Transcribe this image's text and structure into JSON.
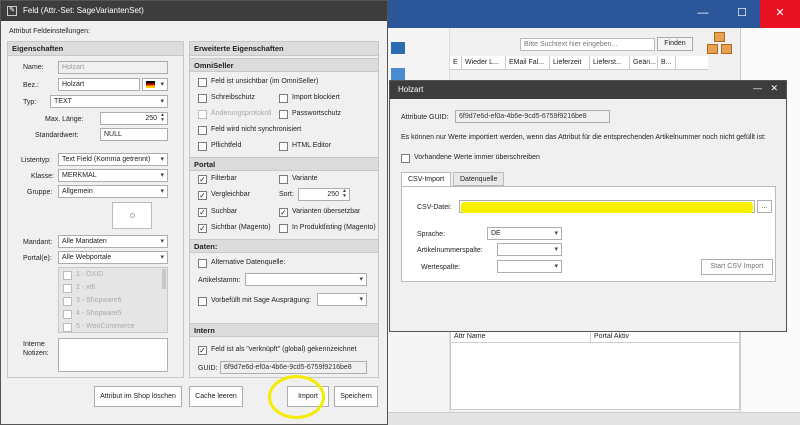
{
  "background_app": {
    "search_placeholder": "Bitte Suchtext hier eingeben...",
    "find_label": "Finden",
    "columns": [
      "E",
      "Wieder L...",
      "EMail Fal...",
      "Lieferzeit",
      "Lieferst...",
      "Geän...",
      "B..."
    ],
    "grid_columns": [
      "Attr Name",
      "Portal Aktiv"
    ]
  },
  "dialog1": {
    "title": "Feld (Attr.-Set: SageVariantenSet)",
    "subtitle": "Attribut Feldeinstellungen:",
    "eigenschaften": {
      "header": "Eigenschaften",
      "name_label": "Name:",
      "name_value": "Holzart",
      "bez_label": "Bez.:",
      "bez_value": "Holzart",
      "typ_label": "Typ:",
      "typ_value": "TEXT",
      "maxlen_label": "Max. Länge:",
      "maxlen_value": "250",
      "standard_label": "Standardwert:",
      "standard_value": "NULL",
      "listentyp_label": "Listentyp:",
      "listentyp_value": "Text Field (Komma getrennt)",
      "klasse_label": "Klasse:",
      "klasse_value": "MERKMAL",
      "gruppe_label": "Gruppe:",
      "gruppe_value": "Allgemein",
      "mandant_label": "Mandant:",
      "mandant_value": "Alle Mandaten",
      "portale_label": "Portal(e):",
      "portale_value": "Alle Webportale",
      "portal_list": [
        "1 - OXID",
        "2 - xt6",
        "3 - Shopware6",
        "4 - Shopware5",
        "5 - WooCommerce"
      ],
      "notizen_label": "Interne Notizen:"
    },
    "erweitert": {
      "header": "Erweiterte Eigenschaften",
      "omniseller_header": "OmniSeller",
      "unsichtbar": "Feld ist unsichtbar (im OmniSeller)",
      "schreibschutz": "Schreibschutz",
      "import_blockiert": "Import blockiert",
      "aenderungsprotokoll": "Änderungsprotokoll",
      "passwortschutz": "Passwortschutz",
      "nicht_sync": "Feld wird nicht synchronisiert",
      "pflichtfeld": "Pflichtfeld",
      "html_editor": "HTML Editor",
      "portal_header": "Portal",
      "filterbar": "Filterbar",
      "variante": "Variante",
      "vergleichbar": "Vergleichbar",
      "sort_label": "Sort:",
      "sort_value": "250",
      "suchbar": "Suchbar",
      "varianten_uebersetzbar": "Varianten übersetzbar",
      "sichtbar_magento": "Sichtbar (Magento)",
      "in_produktlisting": "In Produktlisting (Magento)",
      "daten_header": "Daten:",
      "alternative_datenquelle": "Alternative Datenquelle:",
      "artikelstamm_label": "Artikelstamm:",
      "vorbefuellt": "Vorbefüllt mit Sage Ausprägung:",
      "intern_header": "Intern",
      "verknuepft": "Feld ist als \"verknüpft\" (global) gekennzeichnet",
      "guid_label": "GUID:",
      "guid_value": "6f9d7e6d-ef0a-4b6e-9cd5-6759f9216be8"
    },
    "buttons": {
      "delete": "Attribut im Shop löschen",
      "clear_cache": "Cache leeren",
      "import": "Import",
      "save": "Speichern"
    }
  },
  "dialog2": {
    "title": "Holzart",
    "guid_label": "Attribute GUID:",
    "guid_value": "6f9d7e6d-ef0a-4b6e-9cd5-6759f9216be8",
    "info": "Es können nur Werte importiert werden, wenn das Attribut für die entsprechenden Artikelnummer noch nicht gefüllt ist:",
    "overwrite": "Vorhandene Werte immer überschreiben",
    "tabs": [
      "CSV-Import",
      "Datenquelle"
    ],
    "csv_label": "CSV-Datei:",
    "browse": "...",
    "sprache_label": "Sprache:",
    "sprache_value": "DE",
    "artikelnr_label": "Artikelnummerspalte:",
    "wertespalte_label": "Wertespalte:",
    "start_button": "Start CSV Import"
  },
  "colors": {
    "annotation": "#f5ec00",
    "titlebar": "#3d3d3d"
  }
}
